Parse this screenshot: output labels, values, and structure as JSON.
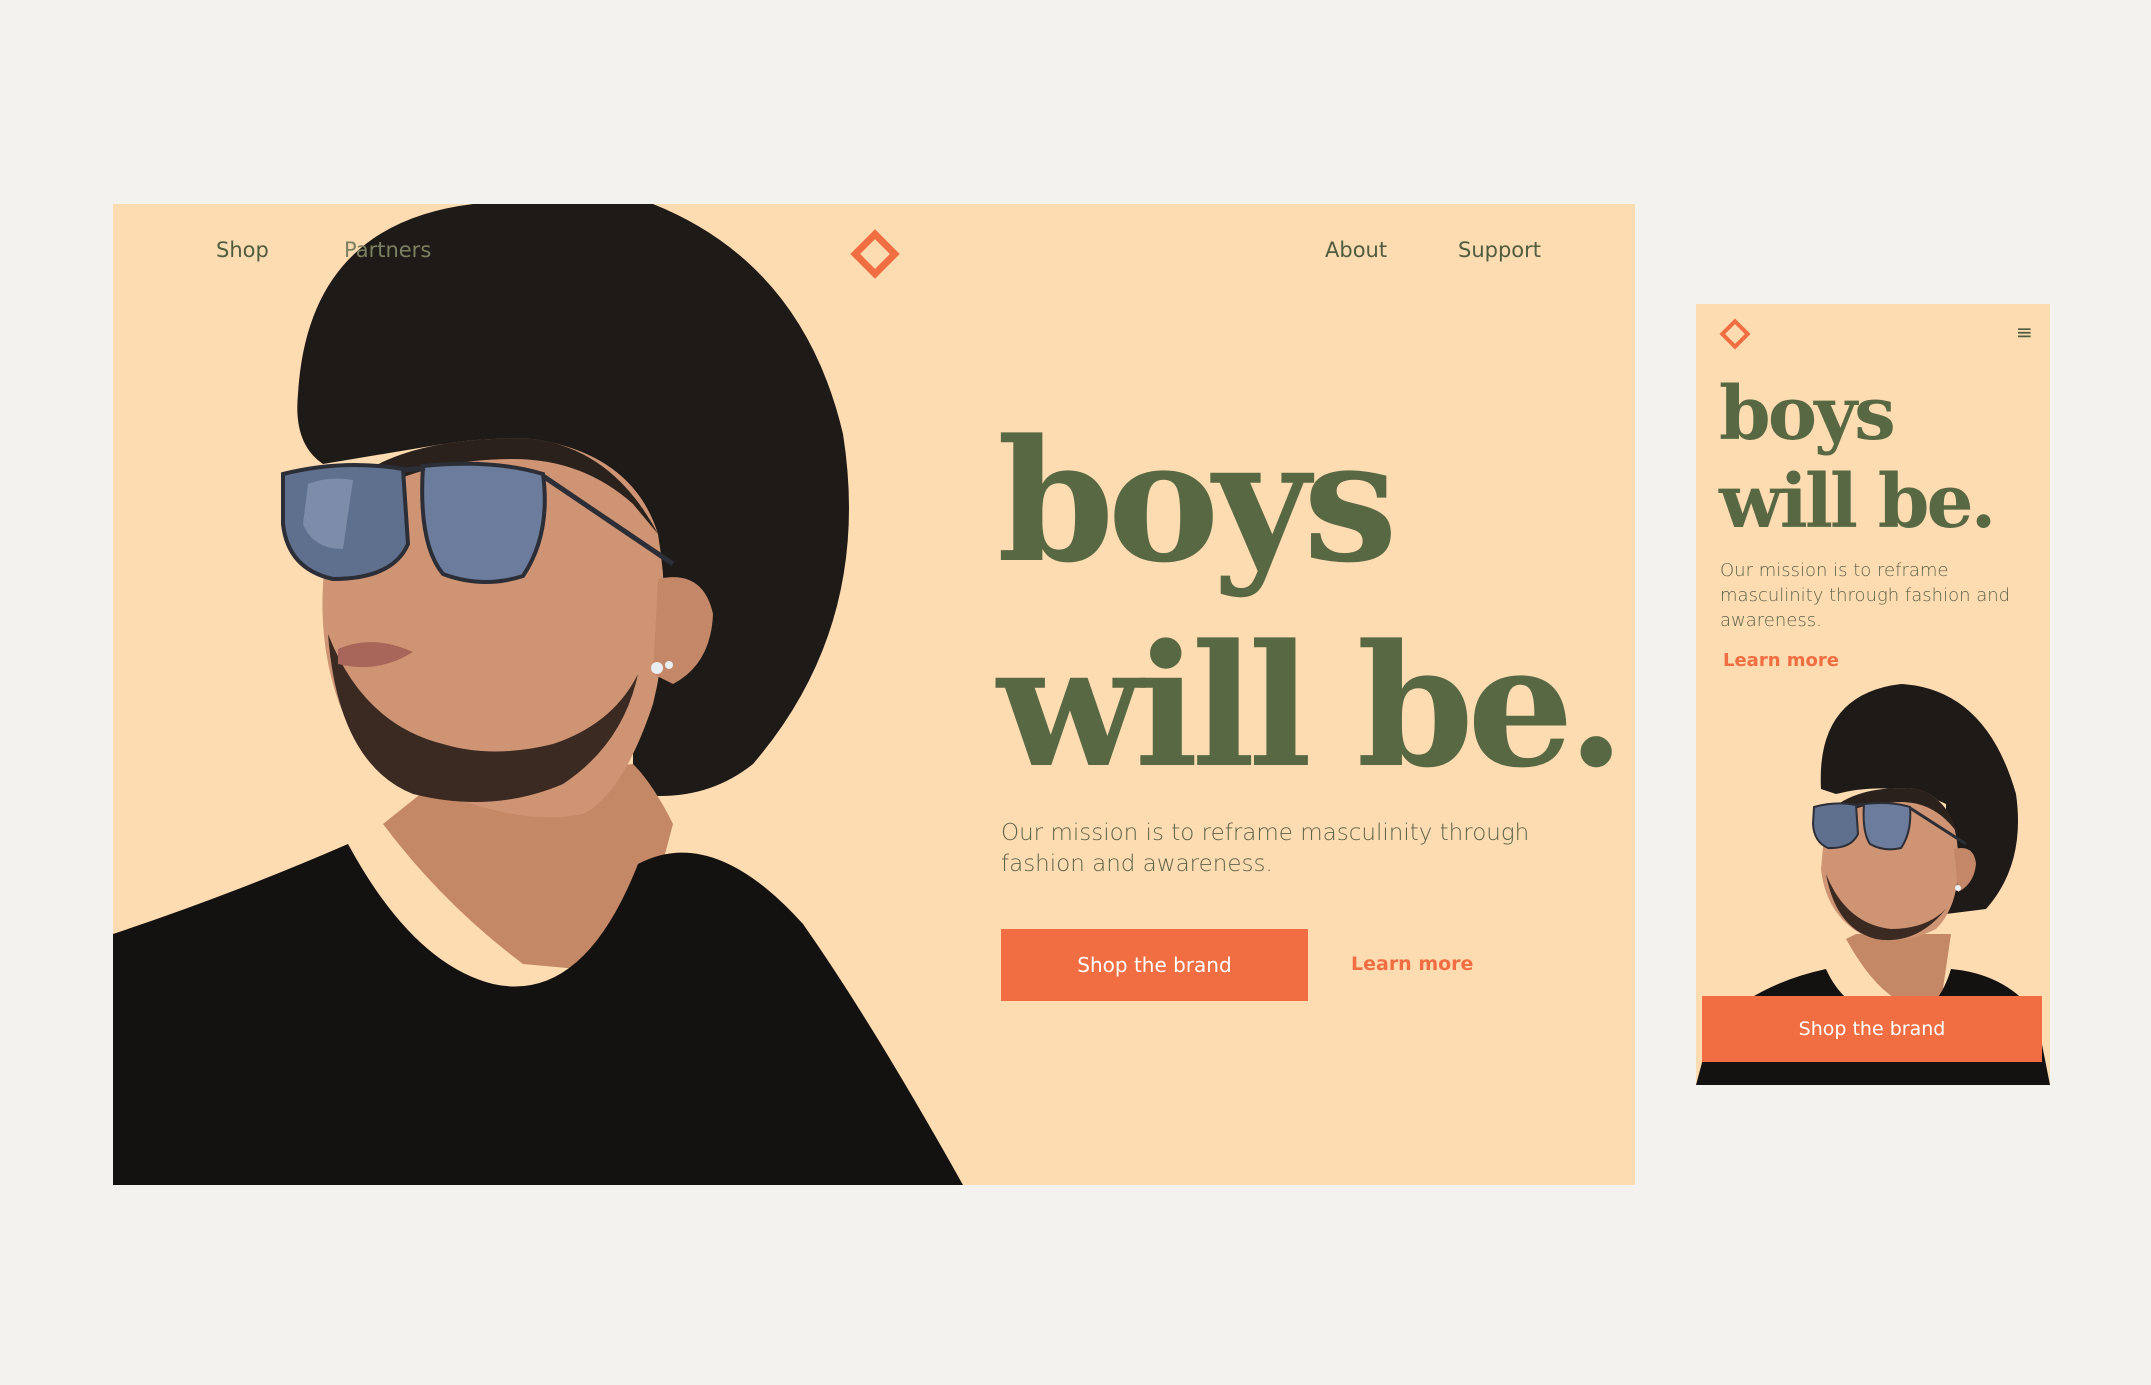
{
  "desktop": {
    "nav_left": [
      {
        "label": "Shop"
      },
      {
        "label": "Partners"
      }
    ],
    "nav_right": [
      {
        "label": "About"
      },
      {
        "label": "Support"
      }
    ],
    "logo_icon": "diamond-outline-icon",
    "headline_line1": "boys",
    "headline_line2": "will be.",
    "mission": "Our mission is to reframe masculinity through fashion and awareness.",
    "cta_label": "Shop the brand",
    "learn_more_label": "Learn more"
  },
  "mobile": {
    "logo_icon": "diamond-outline-icon",
    "menu_icon": "hamburger-menu-icon",
    "menu_glyph": "≡",
    "headline_line1": "boys",
    "headline_line2": "will be.",
    "mission": "Our mission is to reframe masculinity through fashion and awareness.",
    "learn_more_label": "Learn more",
    "cta_label": "Shop the brand"
  },
  "colors": {
    "background": "#f3f2ee",
    "hero_background": "#fedcb2",
    "headline": "#576843",
    "accent": "#f06e42",
    "body_text": "#5b6347"
  }
}
